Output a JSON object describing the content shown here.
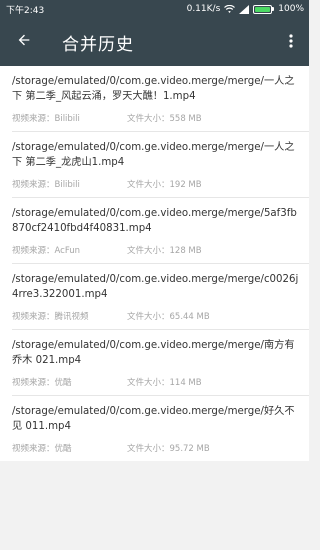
{
  "status_bar": {
    "time": "下午2:43",
    "network_speed": "0.11K/s",
    "battery_percent": "100%"
  },
  "app_bar": {
    "title": "合并历史"
  },
  "labels": {
    "source_prefix": "视频来源：",
    "size_prefix": "文件大小："
  },
  "items": [
    {
      "title": "/storage/emulated/0/com.ge.video.merge/merge/一人之下 第二季_风起云涌，罗天大醮！1.mp4",
      "source": "视频来源：Bilibili",
      "size": "文件大小：558 MB"
    },
    {
      "title": "/storage/emulated/0/com.ge.video.merge/merge/一人之下 第二季_龙虎山1.mp4",
      "source": "视频来源：Bilibili",
      "size": "文件大小：192 MB"
    },
    {
      "title": "/storage/emulated/0/com.ge.video.merge/merge/5af3fb870cf2410fbd4f40831.mp4",
      "source": "视频来源：AcFun",
      "size": "文件大小：128 MB"
    },
    {
      "title": "/storage/emulated/0/com.ge.video.merge/merge/c0026j4rre3.322001.mp4",
      "source": "视频来源：腾讯视频",
      "size": "文件大小：65.44 MB"
    },
    {
      "title": "/storage/emulated/0/com.ge.video.merge/merge/南方有乔木 021.mp4",
      "source": "视频来源：优酷",
      "size": "文件大小：114 MB"
    },
    {
      "title": "/storage/emulated/0/com.ge.video.merge/merge/好久不见 011.mp4",
      "source": "视频来源：优酷",
      "size": "文件大小：95.72 MB"
    }
  ],
  "icons": {
    "back": "arrow-left-icon",
    "more": "more-vert-icon",
    "wifi": "wifi-icon",
    "signal": "signal-icon",
    "battery": "battery-icon"
  },
  "colors": {
    "app_bar": "#38474f",
    "meta_text": "#a6a6a6",
    "title_text": "#333333",
    "battery_fill": "#4cd964"
  }
}
